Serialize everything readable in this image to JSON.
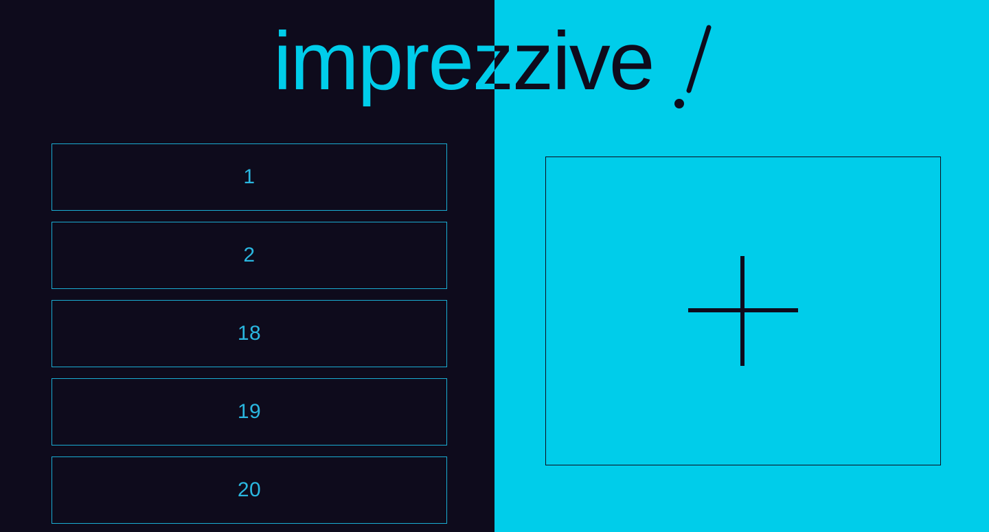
{
  "brand": {
    "title_left": "impre",
    "title_right": "zzive",
    "exclamation": "!",
    "left_color": "#00cdea",
    "right_color": "#0e0b1c"
  },
  "list": {
    "items": [
      {
        "label": "1"
      },
      {
        "label": "2"
      },
      {
        "label": "18"
      },
      {
        "label": "19"
      },
      {
        "label": "20"
      }
    ]
  },
  "add_card": {
    "icon": "plus-icon"
  },
  "colors": {
    "dark": "#0e0b1c",
    "accent": "#00cdea",
    "border": "#1aaed4"
  }
}
